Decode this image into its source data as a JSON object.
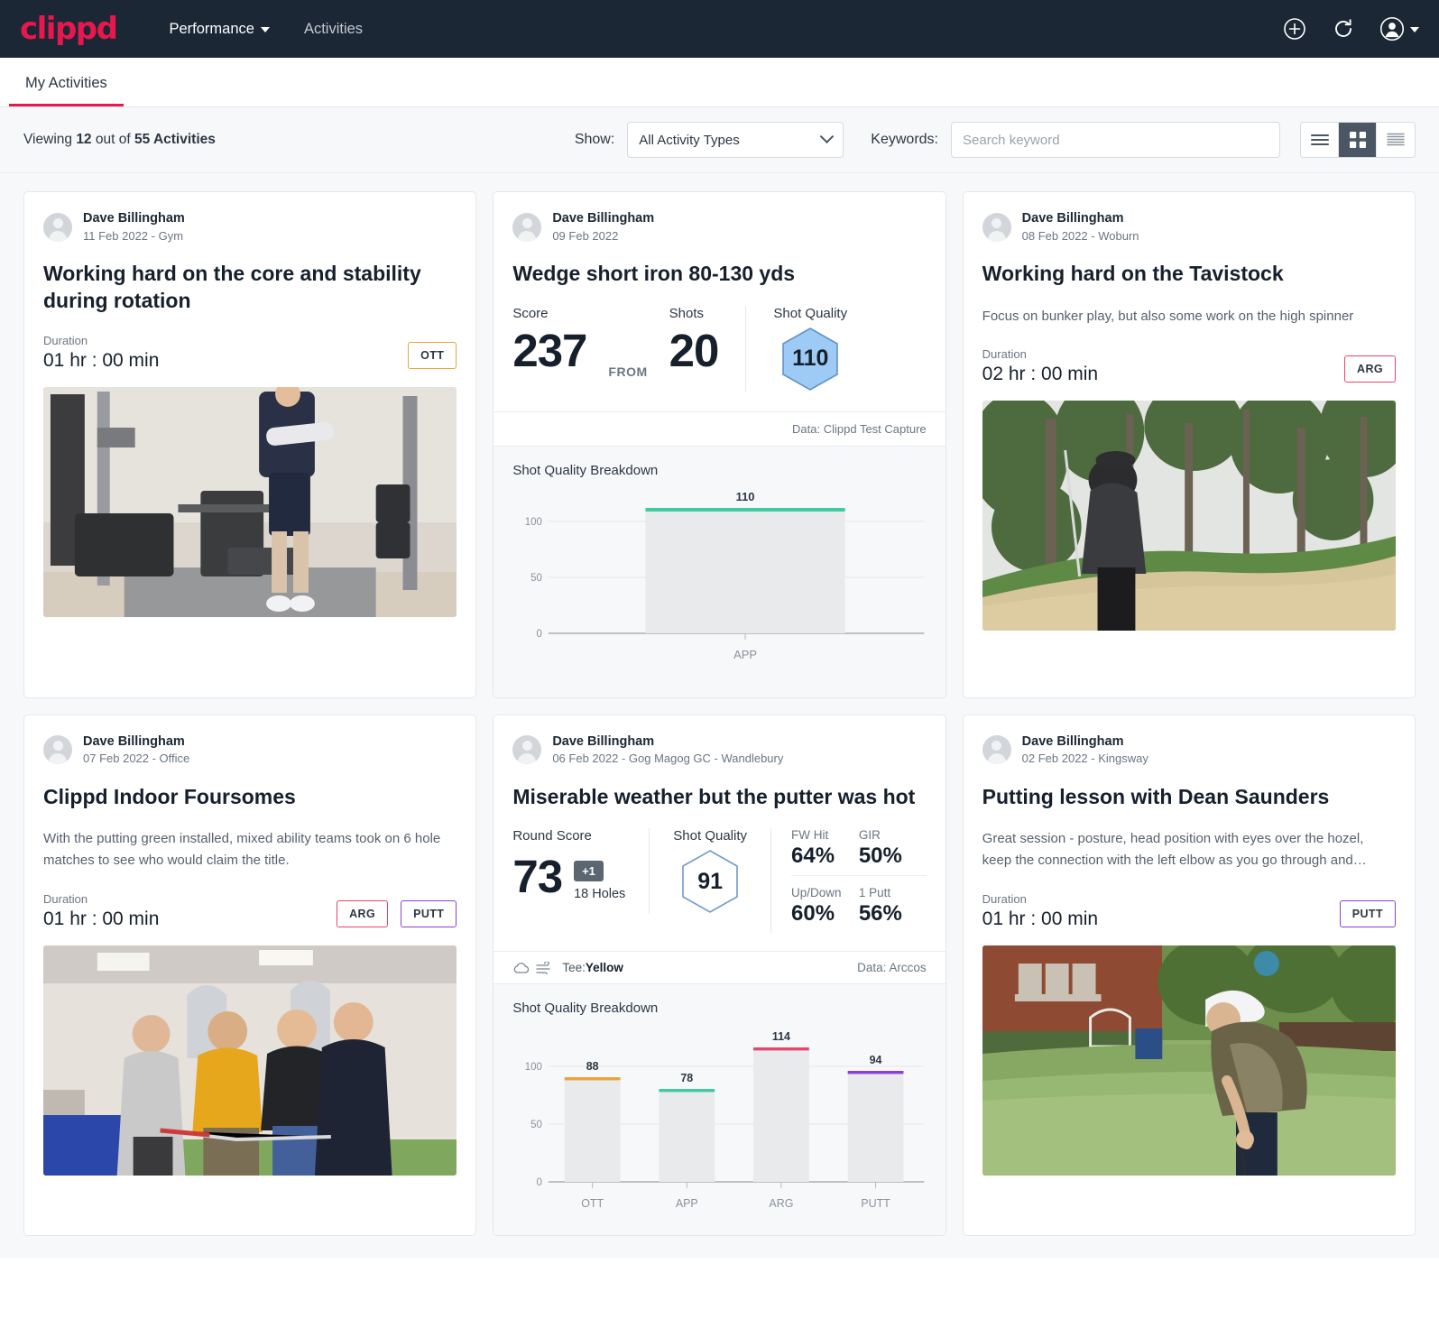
{
  "nav": {
    "logo": "clippd",
    "links": [
      {
        "label": "Performance",
        "has_caret": true
      },
      {
        "label": "Activities",
        "has_caret": false
      }
    ],
    "icons": [
      "add-circle-icon",
      "refresh-icon",
      "account-avatar-icon",
      "chevron-down-icon"
    ]
  },
  "tabs": [
    {
      "label": "My Activities",
      "active": true
    }
  ],
  "filter": {
    "viewing_prefix": "Viewing ",
    "viewing_count": "12",
    "viewing_mid": " out of ",
    "viewing_total": "55",
    "viewing_suffix": " Activities",
    "show_label": "Show:",
    "show_value": "All Activity Types",
    "keywords_label": "Keywords:",
    "search_placeholder": "Search keyword",
    "views": [
      {
        "name": "list-view",
        "active": false
      },
      {
        "name": "grid-view",
        "active": true
      },
      {
        "name": "detail-view",
        "active": false
      }
    ]
  },
  "colors": {
    "brand": "#e8174e",
    "navbg": "#1b2735",
    "ott": "#e8a33d",
    "app": "#3fc9a0",
    "arg": "#e8456b",
    "putt": "#8b3fd6",
    "hex_fill": "#9ecbf5",
    "hex_stroke": "#4a7fb5"
  },
  "cards": [
    {
      "author": "Dave Billingham",
      "meta": "11 Feb 2022 - Gym",
      "title": "Working hard on the core and stability during rotation",
      "desc": "",
      "duration_label": "Duration",
      "duration_value": "01 hr : 00 min",
      "tags": [
        {
          "label": "OTT",
          "cls": "ott"
        }
      ],
      "photo": "gym-training-photo"
    },
    {
      "author": "Dave Billingham",
      "meta": "09 Feb 2022",
      "title": "Wedge short iron 80-130 yds",
      "score_label": "Score",
      "score_value": "237",
      "from_label": "FROM",
      "shots_label": "Shots",
      "shots_value": "20",
      "shot_quality_label": "Shot Quality",
      "shot_quality_value": "110",
      "data_source": "Data: Clippd Test Capture",
      "chart_title": "Shot Quality Breakdown"
    },
    {
      "author": "Dave Billingham",
      "meta": "08 Feb 2022 - Woburn",
      "title": "Working hard on the Tavistock",
      "desc": "Focus on bunker play, but also some work on the high spinner",
      "duration_label": "Duration",
      "duration_value": "02 hr : 00 min",
      "tags": [
        {
          "label": "ARG",
          "cls": "arg"
        }
      ],
      "photo": "bunker-shot-photo"
    },
    {
      "author": "Dave Billingham",
      "meta": "07 Feb 2022 - Office",
      "title": "Clippd Indoor Foursomes",
      "desc": "With the putting green installed, mixed ability teams took on 6 hole matches to see who would claim the title.",
      "duration_label": "Duration",
      "duration_value": "01 hr : 00 min",
      "tags": [
        {
          "label": "ARG",
          "cls": "arg"
        },
        {
          "label": "PUTT",
          "cls": "putt"
        }
      ],
      "photo": "indoor-foursomes-group-photo"
    },
    {
      "author": "Dave Billingham",
      "meta": "06 Feb 2022 - Gog Magog GC - Wandlebury",
      "title": "Miserable weather but the putter was hot",
      "round_score_label": "Round Score",
      "round_score_value": "73",
      "plus_badge": "+1",
      "holes": "18 Holes",
      "shot_quality_label": "Shot Quality",
      "shot_quality_value": "91",
      "pcts": [
        {
          "label": "FW Hit",
          "value": "64%"
        },
        {
          "label": "GIR",
          "value": "50%"
        },
        {
          "label": "Up/Down",
          "value": "60%"
        },
        {
          "label": "1 Putt",
          "value": "56%"
        }
      ],
      "tee_prefix": "Tee: ",
      "tee_value": "Yellow",
      "data_source": "Data: Arccos",
      "chart_title": "Shot Quality Breakdown"
    },
    {
      "author": "Dave Billingham",
      "meta": "02 Feb 2022 - Kingsway",
      "title": "Putting lesson with Dean Saunders",
      "desc": "Great session - posture, head position with eyes over the hozel, keep the connection with the left elbow as you go through and…",
      "duration_label": "Duration",
      "duration_value": "01 hr : 00 min",
      "tags": [
        {
          "label": "PUTT",
          "cls": "putt"
        }
      ],
      "photo": "putting-green-photo"
    }
  ],
  "chart_data": [
    {
      "type": "bar",
      "title": "Shot Quality Breakdown",
      "categories": [
        "APP"
      ],
      "values": [
        110
      ],
      "bar_colors": [
        "#3fc9a0"
      ],
      "ylim": [
        0,
        130
      ],
      "yticks": [
        0,
        50,
        100
      ],
      "ytick_labels": [
        "0",
        "50",
        "100"
      ],
      "xlabel": "",
      "ylabel": "",
      "grid": true,
      "card": "Wedge short iron 80-130 yds"
    },
    {
      "type": "bar",
      "title": "Shot Quality Breakdown",
      "categories": [
        "OTT",
        "APP",
        "ARG",
        "PUTT"
      ],
      "values": [
        88,
        78,
        114,
        94
      ],
      "bar_colors": [
        "#e8a33d",
        "#3fc9a0",
        "#e8456b",
        "#8b3fd6"
      ],
      "ylim": [
        0,
        130
      ],
      "yticks": [
        0,
        50,
        100
      ],
      "ytick_labels": [
        "0",
        "50",
        "100"
      ],
      "xlabel": "",
      "ylabel": "",
      "grid": true,
      "card": "Miserable weather but the putter was hot"
    }
  ]
}
